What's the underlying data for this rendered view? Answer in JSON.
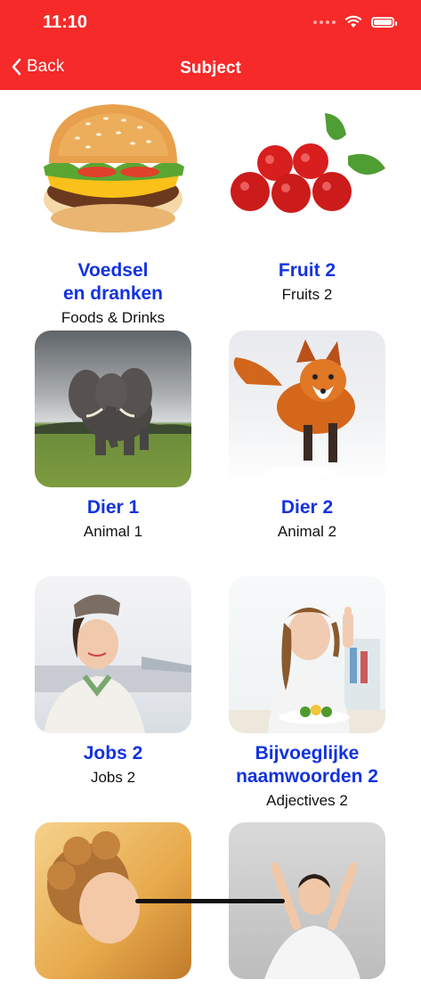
{
  "status": {
    "time": "11:10"
  },
  "nav": {
    "back_label": "Back",
    "title": "Subject"
  },
  "tiles": [
    {
      "title": "Voedsel\nen dranken",
      "subtitle": "Foods & Drinks",
      "image": "burger"
    },
    {
      "title": "Fruit 2",
      "subtitle": "Fruits 2",
      "image": "acerola-cherries"
    },
    {
      "title": "Dier 1",
      "subtitle": "Animal 1",
      "image": "elephant"
    },
    {
      "title": "Dier 2",
      "subtitle": "Animal 2",
      "image": "fox"
    },
    {
      "title": "Jobs 2",
      "subtitle": "Jobs 2",
      "image": "flight-attendant"
    },
    {
      "title": "Bijvoeglijke\nnaamwoorden 2",
      "subtitle": "Adjectives 2",
      "image": "girl-thumbs-up"
    },
    {
      "title": "",
      "subtitle": "",
      "image": "curly-girl"
    },
    {
      "title": "",
      "subtitle": "",
      "image": "happy-woman"
    }
  ],
  "colors": {
    "header": "#f52a29",
    "title": "#1233e0"
  }
}
